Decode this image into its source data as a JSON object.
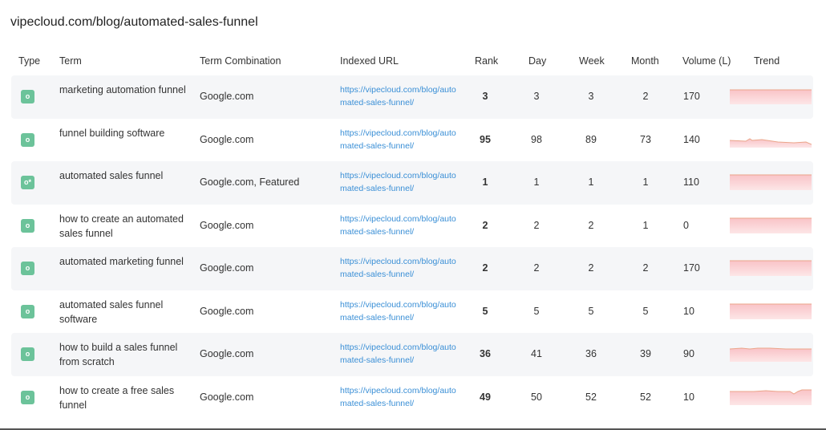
{
  "page_title": "vipecloud.com/blog/automated-sales-funnel",
  "columns": {
    "type": "Type",
    "term": "Term",
    "combo": "Term Combination",
    "url": "Indexed URL",
    "rank": "Rank",
    "day": "Day",
    "week": "Week",
    "month": "Month",
    "volume": "Volume (L)",
    "trend": "Trend"
  },
  "colors": {
    "badge": "#6cc39a",
    "link": "#3a8fd6",
    "trend_fill": "#fbd3d6",
    "trend_line": "#f0b98f"
  },
  "rows": [
    {
      "type_icon": "o",
      "term": "marketing automation funnel",
      "combo": "Google.com",
      "url": "https://vipecloud.com/blog/automated-sales-funnel/",
      "rank": "3",
      "day": "3",
      "week": "3",
      "month": "2",
      "volume": "170"
    },
    {
      "type_icon": "o",
      "term": "funnel building software",
      "combo": "Google.com",
      "url": "https://vipecloud.com/blog/automated-sales-funnel/",
      "rank": "95",
      "day": "98",
      "week": "89",
      "month": "73",
      "volume": "140"
    },
    {
      "type_icon": "o*",
      "term": "automated sales funnel",
      "combo": "Google.com, Featured",
      "url": "https://vipecloud.com/blog/automated-sales-funnel/",
      "rank": "1",
      "day": "1",
      "week": "1",
      "month": "1",
      "volume": "110"
    },
    {
      "type_icon": "o",
      "term": "how to create an automated sales funnel",
      "combo": "Google.com",
      "url": "https://vipecloud.com/blog/automated-sales-funnel/",
      "rank": "2",
      "day": "2",
      "week": "2",
      "month": "1",
      "volume": "0"
    },
    {
      "type_icon": "o",
      "term": "automated marketing funnel",
      "combo": "Google.com",
      "url": "https://vipecloud.com/blog/automated-sales-funnel/",
      "rank": "2",
      "day": "2",
      "week": "2",
      "month": "2",
      "volume": "170"
    },
    {
      "type_icon": "o",
      "term": "automated sales funnel software",
      "combo": "Google.com",
      "url": "https://vipecloud.com/blog/automated-sales-funnel/",
      "rank": "5",
      "day": "5",
      "week": "5",
      "month": "5",
      "volume": "10"
    },
    {
      "type_icon": "o",
      "term": "how to build a sales funnel from scratch",
      "combo": "Google.com",
      "url": "https://vipecloud.com/blog/automated-sales-funnel/",
      "rank": "36",
      "day": "41",
      "week": "36",
      "month": "39",
      "volume": "90"
    },
    {
      "type_icon": "o",
      "term": "how to create a free sales funnel",
      "combo": "Google.com",
      "url": "https://vipecloud.com/blog/automated-sales-funnel/",
      "rank": "49",
      "day": "50",
      "week": "52",
      "month": "52",
      "volume": "10"
    }
  ]
}
